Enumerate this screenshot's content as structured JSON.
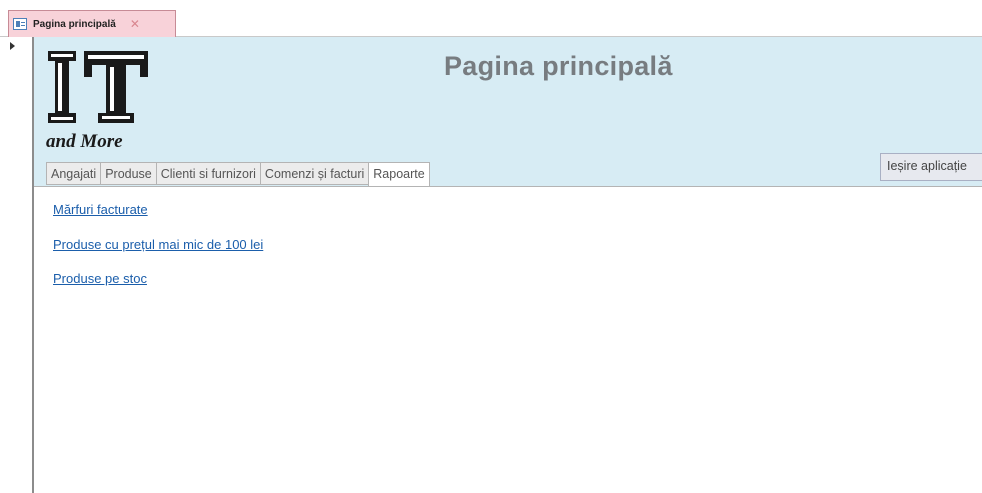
{
  "document_tab": {
    "title": "Pagina principală",
    "form_icon": "form-icon",
    "close_icon": "close-icon"
  },
  "header": {
    "title": "Pagina principală",
    "logo_text": "IT and More",
    "exit_button_label": "Ieșire aplicație"
  },
  "tabs": [
    {
      "label": "Angajati",
      "active": false
    },
    {
      "label": "Produse",
      "active": false
    },
    {
      "label": "Clienti si furnizori",
      "active": false
    },
    {
      "label": "Comenzi și facturi",
      "active": false
    },
    {
      "label": "Rapoarte",
      "active": true
    }
  ],
  "reports": {
    "links": [
      {
        "label": "Mărfuri facturate"
      },
      {
        "label": "Produse cu prețul mai mic de 100 lei"
      },
      {
        "label": "Produse pe stoc"
      }
    ]
  },
  "colors": {
    "header_background": "#d7ecf4",
    "document_tab": "#f8d2d9",
    "link": "#1b5eab"
  }
}
